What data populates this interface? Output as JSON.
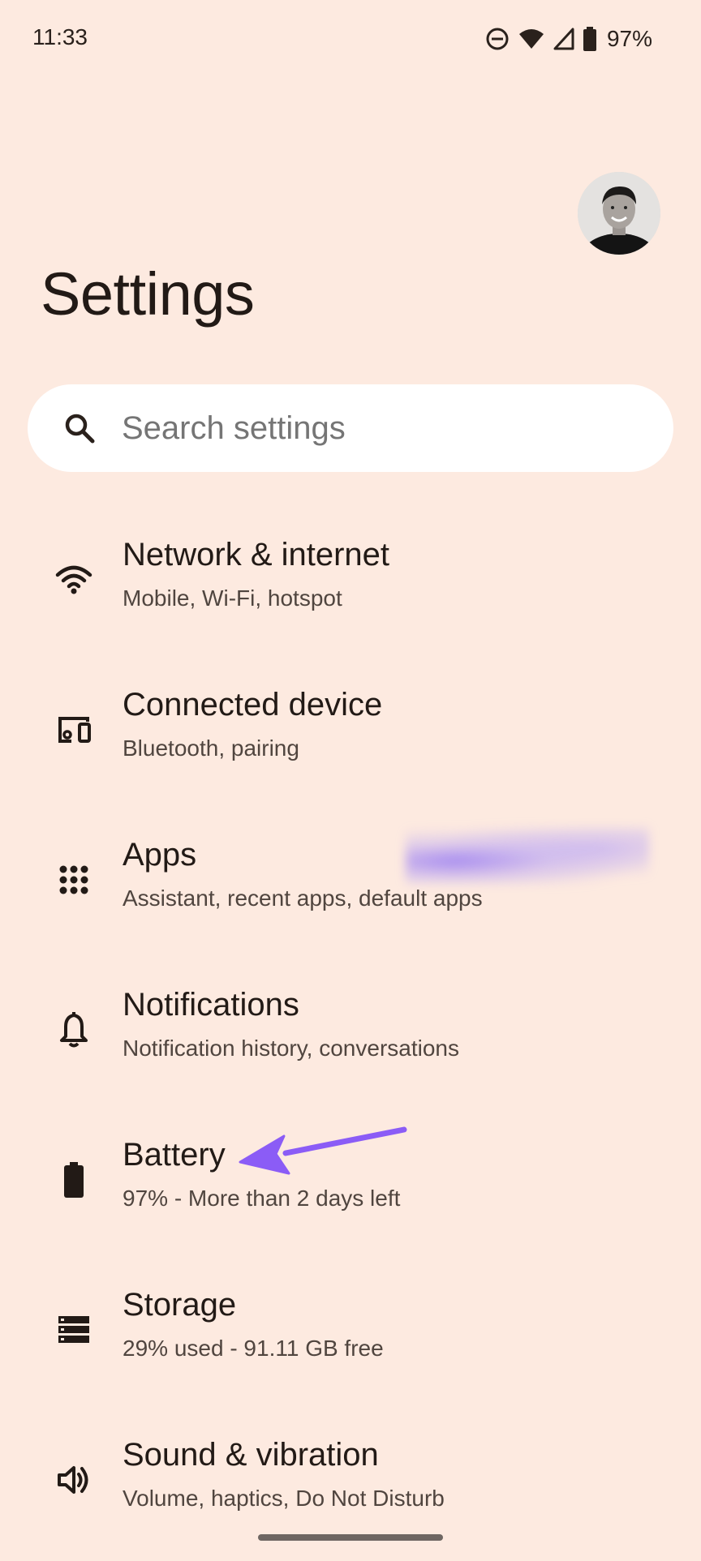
{
  "status_bar": {
    "time": "11:33",
    "battery_percent": "97%",
    "icons": [
      "do-not-disturb-icon",
      "wifi-icon",
      "cell-signal-icon",
      "battery-icon"
    ]
  },
  "header": {
    "title": "Settings",
    "avatar_icon": "profile-photo"
  },
  "search": {
    "placeholder": "Search settings",
    "icon": "search-icon"
  },
  "settings_items": [
    {
      "icon": "wifi-icon",
      "title": "Network & internet",
      "subtitle": "Mobile, Wi-Fi, hotspot"
    },
    {
      "icon": "devices-icon",
      "title": "Connected device",
      "subtitle": "Bluetooth, pairing"
    },
    {
      "icon": "apps-grid-icon",
      "title": "Apps",
      "subtitle": "Assistant, recent apps, default apps"
    },
    {
      "icon": "bell-icon",
      "title": "Notifications",
      "subtitle": "Notification history, conversations"
    },
    {
      "icon": "battery-icon",
      "title": "Battery",
      "subtitle": "97% - More than 2 days left"
    },
    {
      "icon": "storage-icon",
      "title": "Storage",
      "subtitle": "29% used - 91.11 GB free"
    },
    {
      "icon": "speaker-icon",
      "title": "Sound & vibration",
      "subtitle": "Volume, haptics, Do Not Disturb"
    }
  ],
  "colors": {
    "background": "#fdeae0",
    "search_bar": "#ffffff",
    "text_primary": "#221a16",
    "text_secondary": "#50453f",
    "annotation_arrow": "#8b5cf6"
  }
}
